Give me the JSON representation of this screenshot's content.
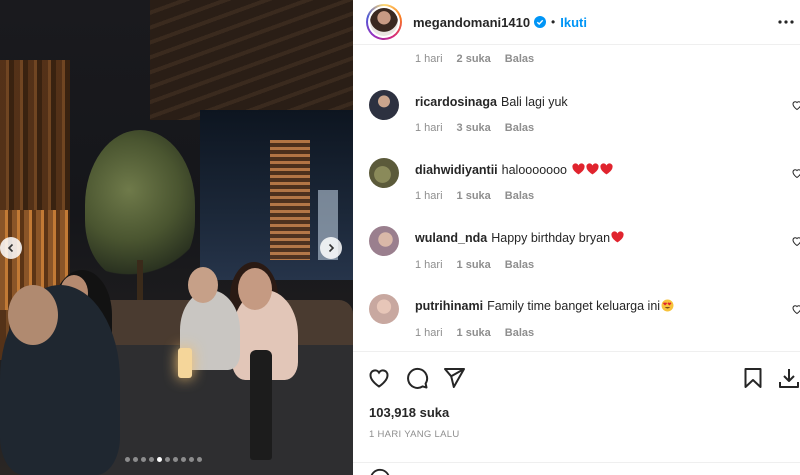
{
  "post": {
    "carousel_dots": 10,
    "active_dot": 4
  },
  "header": {
    "username": "megandomani1410",
    "separator": "•",
    "follow_label": "Ikuti"
  },
  "comments": {
    "first_meta": {
      "time": "1 hari",
      "likes": "2 suka",
      "reply": "Balas"
    },
    "items": [
      {
        "username": "ricardosinaga",
        "text": "Bali lagi yuk",
        "emoji": "",
        "time": "1 hari",
        "likes": "3 suka",
        "reply": "Balas"
      },
      {
        "username": "diahwidiyantii",
        "text": "halooooooo",
        "emoji": "heart-x3",
        "time": "1 hari",
        "likes": "1 suka",
        "reply": "Balas"
      },
      {
        "username": "wuland_nda",
        "text": "Happy birthday bryan",
        "emoji": "heart",
        "time": "1 hari",
        "likes": "1 suka",
        "reply": "Balas"
      },
      {
        "username": "putrihinami",
        "text": "Family time banget keluarga ini",
        "emoji": "heart-eyes",
        "time": "1 hari",
        "likes": "1 suka",
        "reply": "Balas"
      }
    ]
  },
  "actions": {
    "likes_text": "103,918 suka",
    "posted_time": "1 HARI YANG LALU"
  },
  "colors": {
    "link_blue": "#0095f6",
    "muted": "#8e8e8e",
    "heart_red": "#e0242e"
  }
}
